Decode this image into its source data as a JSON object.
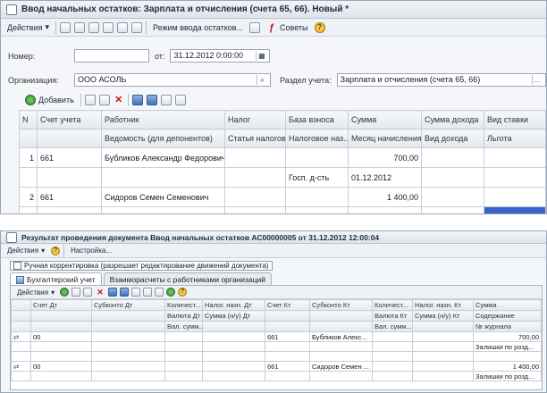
{
  "window1": {
    "title": "Ввод начальных остатков: Зарплата и отчисления (счета 65, 66). Новый *",
    "toolbar": {
      "actions": "Действия",
      "mode": "Режим ввода остатков...",
      "tips": "Советы"
    },
    "number_label": "Номер:",
    "number_value": "",
    "from_label": "от:",
    "date_value": "31.12.2012  0:00:00",
    "org_label": "Организация:",
    "org_value": "ООО АСОЛЬ",
    "section_label": "Раздел учета:",
    "section_value": "Зарплата и отчисления (счета 65, 66)",
    "grid_toolbar": {
      "add": "Добавить"
    },
    "columns_top": [
      "N",
      "Счет учета",
      "Работник",
      "Налог",
      "База взноса",
      "Сумма",
      "Сумма дохода",
      "Вид ставки"
    ],
    "columns_bottom": [
      "",
      "",
      "Ведомость (для депонентов)",
      "Статья налогов...",
      "Налоговое наз...",
      "Месяц начисления",
      "Вид дохода",
      "Льгота"
    ],
    "rows": [
      {
        "n": "1",
        "account": "661",
        "worker": "Бубликов Александр Федорович",
        "tax": "",
        "base": "",
        "sum": "700,00",
        "income": "",
        "rate": "",
        "base2": "Госп. д-сть",
        "month": "01.12.2012"
      },
      {
        "n": "2",
        "account": "661",
        "worker": "Сидоров Семен Семенович",
        "tax": "",
        "base": "",
        "sum": "1 400,00",
        "income": "",
        "rate": "",
        "base2": "Госп. д-сть",
        "month": "01.12.2012"
      }
    ]
  },
  "window2": {
    "title": "Результат проведения документа Ввод начальных остатков АС00000005 от 31.12.2012 12:00:04",
    "toolbar": {
      "actions": "Действия",
      "settings": "Настройка..."
    },
    "manual_label": "Ручная корректировка (разрешает редактирование движений документа)",
    "tabs": [
      "Бухгалтерский учет",
      "Взаиморасчеты с работниками организаций"
    ],
    "inner_actions": "Действия",
    "columns_r1": [
      "",
      "Счет Дт",
      "Субконто Дт",
      "Количест...",
      "Налог. назн. Дт",
      "Счет Кт",
      "Субконто Кт",
      "Количест...",
      "Налог. назн. Кт",
      "Сумма"
    ],
    "columns_r2": [
      "",
      "",
      "",
      "Валюта Дт",
      "Сумма (н/у) Дт",
      "",
      "",
      "Валюта Кт",
      "Сумма (н/у) Кт",
      "Содержание"
    ],
    "columns_r3": [
      "",
      "",
      "",
      "Вал. сумм...",
      "",
      "",
      "",
      "Вал. сумм...",
      "",
      "№ журнала"
    ],
    "rows": [
      {
        "dt": "00",
        "kt": "661",
        "sub_kt": "Бубликов Алекс...",
        "sum": "700,00",
        "content": "Залишки по розд..."
      },
      {
        "dt": "00",
        "kt": "661",
        "sub_kt": "Сидоров Семен ...",
        "sum": "1 400,00",
        "content": "Залишки по розд..."
      }
    ]
  }
}
